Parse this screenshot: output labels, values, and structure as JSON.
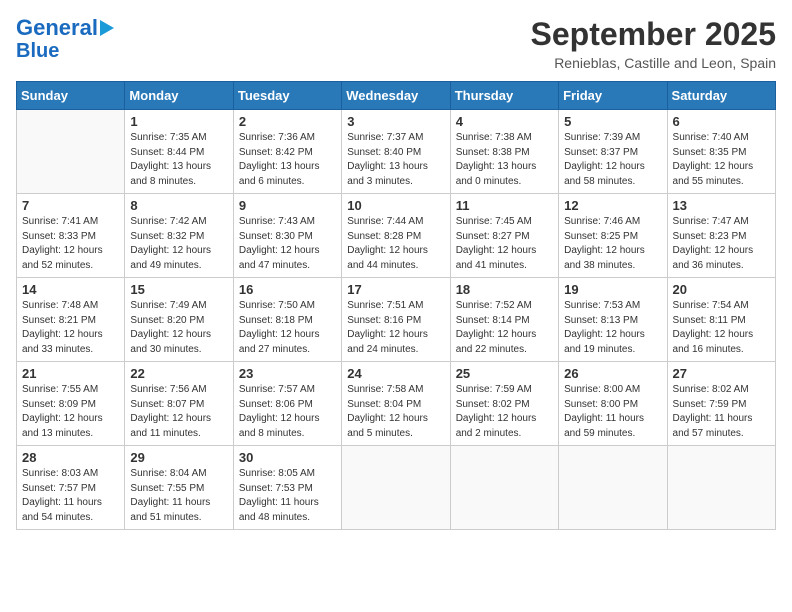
{
  "logo": {
    "line1": "General",
    "line2": "Blue"
  },
  "title": "September 2025",
  "subtitle": "Renieblas, Castille and Leon, Spain",
  "weekdays": [
    "Sunday",
    "Monday",
    "Tuesday",
    "Wednesday",
    "Thursday",
    "Friday",
    "Saturday"
  ],
  "weeks": [
    [
      {
        "day": "",
        "info": ""
      },
      {
        "day": "1",
        "info": "Sunrise: 7:35 AM\nSunset: 8:44 PM\nDaylight: 13 hours\nand 8 minutes."
      },
      {
        "day": "2",
        "info": "Sunrise: 7:36 AM\nSunset: 8:42 PM\nDaylight: 13 hours\nand 6 minutes."
      },
      {
        "day": "3",
        "info": "Sunrise: 7:37 AM\nSunset: 8:40 PM\nDaylight: 13 hours\nand 3 minutes."
      },
      {
        "day": "4",
        "info": "Sunrise: 7:38 AM\nSunset: 8:38 PM\nDaylight: 13 hours\nand 0 minutes."
      },
      {
        "day": "5",
        "info": "Sunrise: 7:39 AM\nSunset: 8:37 PM\nDaylight: 12 hours\nand 58 minutes."
      },
      {
        "day": "6",
        "info": "Sunrise: 7:40 AM\nSunset: 8:35 PM\nDaylight: 12 hours\nand 55 minutes."
      }
    ],
    [
      {
        "day": "7",
        "info": "Sunrise: 7:41 AM\nSunset: 8:33 PM\nDaylight: 12 hours\nand 52 minutes."
      },
      {
        "day": "8",
        "info": "Sunrise: 7:42 AM\nSunset: 8:32 PM\nDaylight: 12 hours\nand 49 minutes."
      },
      {
        "day": "9",
        "info": "Sunrise: 7:43 AM\nSunset: 8:30 PM\nDaylight: 12 hours\nand 47 minutes."
      },
      {
        "day": "10",
        "info": "Sunrise: 7:44 AM\nSunset: 8:28 PM\nDaylight: 12 hours\nand 44 minutes."
      },
      {
        "day": "11",
        "info": "Sunrise: 7:45 AM\nSunset: 8:27 PM\nDaylight: 12 hours\nand 41 minutes."
      },
      {
        "day": "12",
        "info": "Sunrise: 7:46 AM\nSunset: 8:25 PM\nDaylight: 12 hours\nand 38 minutes."
      },
      {
        "day": "13",
        "info": "Sunrise: 7:47 AM\nSunset: 8:23 PM\nDaylight: 12 hours\nand 36 minutes."
      }
    ],
    [
      {
        "day": "14",
        "info": "Sunrise: 7:48 AM\nSunset: 8:21 PM\nDaylight: 12 hours\nand 33 minutes."
      },
      {
        "day": "15",
        "info": "Sunrise: 7:49 AM\nSunset: 8:20 PM\nDaylight: 12 hours\nand 30 minutes."
      },
      {
        "day": "16",
        "info": "Sunrise: 7:50 AM\nSunset: 8:18 PM\nDaylight: 12 hours\nand 27 minutes."
      },
      {
        "day": "17",
        "info": "Sunrise: 7:51 AM\nSunset: 8:16 PM\nDaylight: 12 hours\nand 24 minutes."
      },
      {
        "day": "18",
        "info": "Sunrise: 7:52 AM\nSunset: 8:14 PM\nDaylight: 12 hours\nand 22 minutes."
      },
      {
        "day": "19",
        "info": "Sunrise: 7:53 AM\nSunset: 8:13 PM\nDaylight: 12 hours\nand 19 minutes."
      },
      {
        "day": "20",
        "info": "Sunrise: 7:54 AM\nSunset: 8:11 PM\nDaylight: 12 hours\nand 16 minutes."
      }
    ],
    [
      {
        "day": "21",
        "info": "Sunrise: 7:55 AM\nSunset: 8:09 PM\nDaylight: 12 hours\nand 13 minutes."
      },
      {
        "day": "22",
        "info": "Sunrise: 7:56 AM\nSunset: 8:07 PM\nDaylight: 12 hours\nand 11 minutes."
      },
      {
        "day": "23",
        "info": "Sunrise: 7:57 AM\nSunset: 8:06 PM\nDaylight: 12 hours\nand 8 minutes."
      },
      {
        "day": "24",
        "info": "Sunrise: 7:58 AM\nSunset: 8:04 PM\nDaylight: 12 hours\nand 5 minutes."
      },
      {
        "day": "25",
        "info": "Sunrise: 7:59 AM\nSunset: 8:02 PM\nDaylight: 12 hours\nand 2 minutes."
      },
      {
        "day": "26",
        "info": "Sunrise: 8:00 AM\nSunset: 8:00 PM\nDaylight: 11 hours\nand 59 minutes."
      },
      {
        "day": "27",
        "info": "Sunrise: 8:02 AM\nSunset: 7:59 PM\nDaylight: 11 hours\nand 57 minutes."
      }
    ],
    [
      {
        "day": "28",
        "info": "Sunrise: 8:03 AM\nSunset: 7:57 PM\nDaylight: 11 hours\nand 54 minutes."
      },
      {
        "day": "29",
        "info": "Sunrise: 8:04 AM\nSunset: 7:55 PM\nDaylight: 11 hours\nand 51 minutes."
      },
      {
        "day": "30",
        "info": "Sunrise: 8:05 AM\nSunset: 7:53 PM\nDaylight: 11 hours\nand 48 minutes."
      },
      {
        "day": "",
        "info": ""
      },
      {
        "day": "",
        "info": ""
      },
      {
        "day": "",
        "info": ""
      },
      {
        "day": "",
        "info": ""
      }
    ]
  ]
}
